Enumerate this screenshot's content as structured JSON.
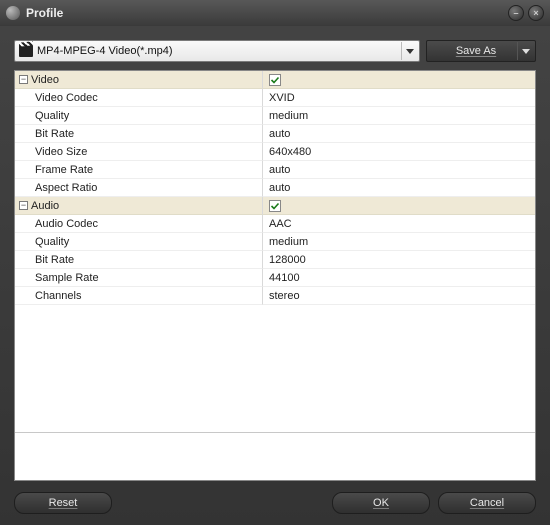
{
  "window": {
    "title": "Profile"
  },
  "toolbar": {
    "profile_selected": "MP4-MPEG-4 Video(*.mp4)",
    "save_as": "Save As"
  },
  "groups": [
    {
      "name": "Video",
      "checked": true,
      "props": [
        {
          "key": "Video Codec",
          "value": "XVID"
        },
        {
          "key": "Quality",
          "value": "medium"
        },
        {
          "key": "Bit Rate",
          "value": "auto"
        },
        {
          "key": "Video Size",
          "value": "640x480"
        },
        {
          "key": "Frame Rate",
          "value": "auto"
        },
        {
          "key": "Aspect Ratio",
          "value": "auto"
        }
      ]
    },
    {
      "name": "Audio",
      "checked": true,
      "props": [
        {
          "key": "Audio Codec",
          "value": "AAC"
        },
        {
          "key": "Quality",
          "value": "medium"
        },
        {
          "key": "Bit Rate",
          "value": "128000"
        },
        {
          "key": "Sample Rate",
          "value": "44100"
        },
        {
          "key": "Channels",
          "value": "stereo"
        }
      ]
    }
  ],
  "footer": {
    "reset": "Reset",
    "ok": "OK",
    "cancel": "Cancel"
  }
}
